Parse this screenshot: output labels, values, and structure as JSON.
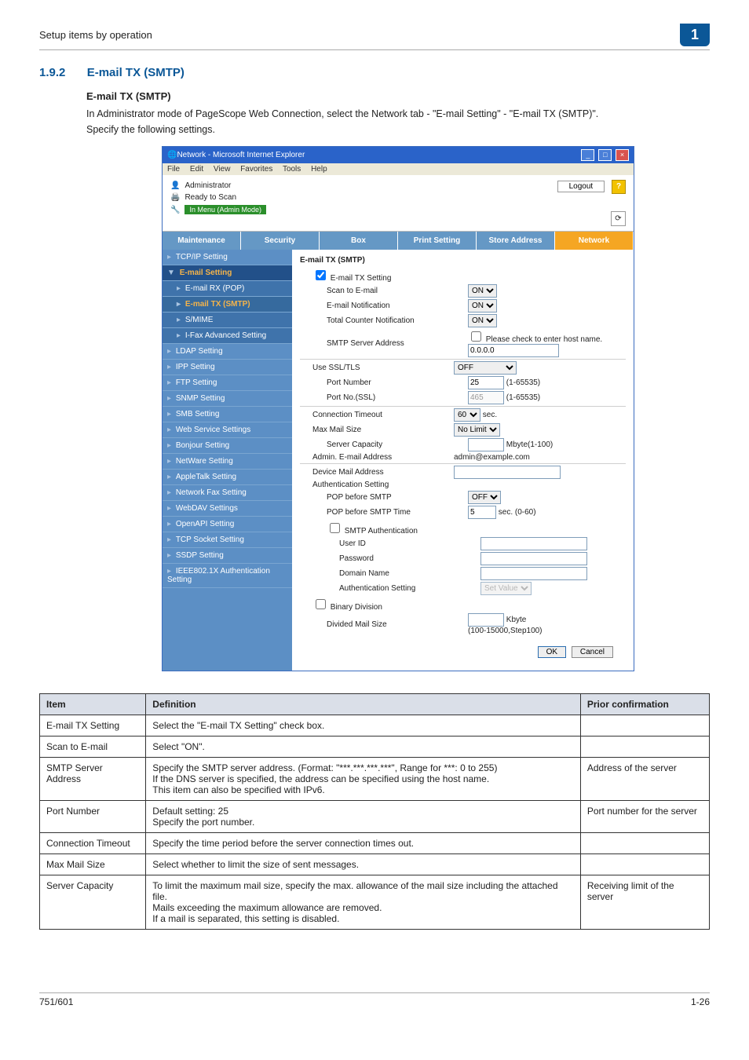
{
  "page_header": "Setup items by operation",
  "chapter_badge": "1",
  "section": {
    "num": "1.9.2",
    "title": "E-mail TX (SMTP)"
  },
  "subheading": "E-mail TX (SMTP)",
  "para1": "In Administrator mode of PageScope Web Connection, select the Network tab - \"E-mail Setting\" - \"E-mail TX (SMTP)\".",
  "para2": "Specify the following settings.",
  "window": {
    "title": "Network - Microsoft Internet Explorer",
    "menus": [
      "File",
      "Edit",
      "View",
      "Favorites",
      "Tools",
      "Help"
    ],
    "admin_label": "Administrator",
    "logout": "Logout",
    "status_ready": "Ready to Scan",
    "status_mode": "In Menu (Admin Mode)"
  },
  "tabs": [
    "Maintenance",
    "Security",
    "Box",
    "Print Setting",
    "Store Address",
    "Network"
  ],
  "tab_selected_index": 5,
  "sidebar": [
    {
      "label": "TCP/IP Setting"
    },
    {
      "label": "E-mail Setting",
      "expanded": true
    },
    {
      "label": "E-mail RX (POP)",
      "sub": true
    },
    {
      "label": "E-mail TX (SMTP)",
      "sub": true,
      "active": true
    },
    {
      "label": "S/MIME",
      "sub": true
    },
    {
      "label": "I-Fax Advanced Setting",
      "sub": true
    },
    {
      "label": "LDAP Setting"
    },
    {
      "label": "IPP Setting"
    },
    {
      "label": "FTP Setting"
    },
    {
      "label": "SNMP Setting"
    },
    {
      "label": "SMB Setting"
    },
    {
      "label": "Web Service Settings"
    },
    {
      "label": "Bonjour Setting"
    },
    {
      "label": "NetWare Setting"
    },
    {
      "label": "AppleTalk Setting"
    },
    {
      "label": "Network Fax Setting"
    },
    {
      "label": "WebDAV Settings"
    },
    {
      "label": "OpenAPI Setting"
    },
    {
      "label": "TCP Socket Setting"
    },
    {
      "label": "SSDP Setting"
    },
    {
      "label": "IEEE802.1X Authentication Setting"
    }
  ],
  "form": {
    "title": "E-mail TX (SMTP)",
    "check_label": "E-mail TX Setting",
    "rows": {
      "scan_to_email": {
        "lbl": "Scan to E-mail",
        "val": "ON"
      },
      "email_notification": {
        "lbl": "E-mail Notification",
        "val": "ON"
      },
      "total_counter": {
        "lbl": "Total Counter Notification",
        "val": "ON"
      },
      "smtp_addr_lbl": "SMTP Server Address",
      "smtp_addr_hint": "Please check to enter host name.",
      "smtp_addr_val": "0.0.0.0",
      "use_ssl": {
        "lbl": "Use SSL/TLS",
        "val": "OFF"
      },
      "port_no": {
        "lbl": "Port Number",
        "val": "25",
        "hint": "(1-65535)"
      },
      "port_ssl": {
        "lbl": "Port No.(SSL)",
        "val": "465",
        "hint": "(1-65535)"
      },
      "conn_timeout": {
        "lbl": "Connection Timeout",
        "val": "60",
        "unit": "sec."
      },
      "max_mail": {
        "lbl": "Max Mail Size",
        "val": "No Limit"
      },
      "server_cap": {
        "lbl": "Server Capacity",
        "unit": "Mbyte(1-100)"
      },
      "admin_email": {
        "lbl": "Admin. E-mail Address",
        "val": "admin@example.com"
      },
      "device_email": "Device Mail Address",
      "auth_setting": "Authentication Setting",
      "pop_before": {
        "lbl": "POP before SMTP",
        "val": "OFF"
      },
      "pop_time": {
        "lbl": "POP before SMTP Time",
        "val": "5",
        "unit": "sec. (0-60)"
      },
      "smtp_auth": "SMTP Authentication",
      "user_id": "User ID",
      "password": "Password",
      "domain": "Domain Name",
      "auth_set2": {
        "lbl": "Authentication Setting",
        "val": "Set Value"
      },
      "binary": "Binary Division",
      "divided": {
        "lbl": "Divided Mail Size",
        "unit": "Kbyte",
        "hint": "(100-15000,Step100)"
      }
    },
    "ok": "OK",
    "cancel": "Cancel"
  },
  "table": {
    "head": [
      "Item",
      "Definition",
      "Prior confirmation"
    ],
    "rows": [
      {
        "item": "E-mail TX Setting",
        "def": "Select the \"E-mail TX Setting\" check box.",
        "prior": ""
      },
      {
        "item": "Scan to E-mail",
        "def": "Select \"ON\".",
        "prior": ""
      },
      {
        "item": "SMTP Server Address",
        "def": "Specify the SMTP server address. (Format: \"***.***.***.***\", Range for ***: 0 to 255)\nIf the DNS server is specified, the address can be specified using the host name.\nThis item can also be specified with IPv6.",
        "prior": "Address of the server"
      },
      {
        "item": "Port Number",
        "def": "Default setting: 25\nSpecify the port number.",
        "prior": "Port number for the server"
      },
      {
        "item": "Connection Timeout",
        "def": "Specify the time period before the server connection times out.",
        "prior": ""
      },
      {
        "item": "Max Mail Size",
        "def": "Select whether to limit the size of sent messages.",
        "prior": ""
      },
      {
        "item": "Server Capacity",
        "def": "To limit the maximum mail size, specify the max. allowance of the mail size including the attached file.\nMails exceeding the maximum allowance are removed.\nIf a mail is separated, this setting is disabled.",
        "prior": "Receiving limit of the server"
      }
    ]
  },
  "footer": {
    "left": "751/601",
    "right": "1-26"
  }
}
